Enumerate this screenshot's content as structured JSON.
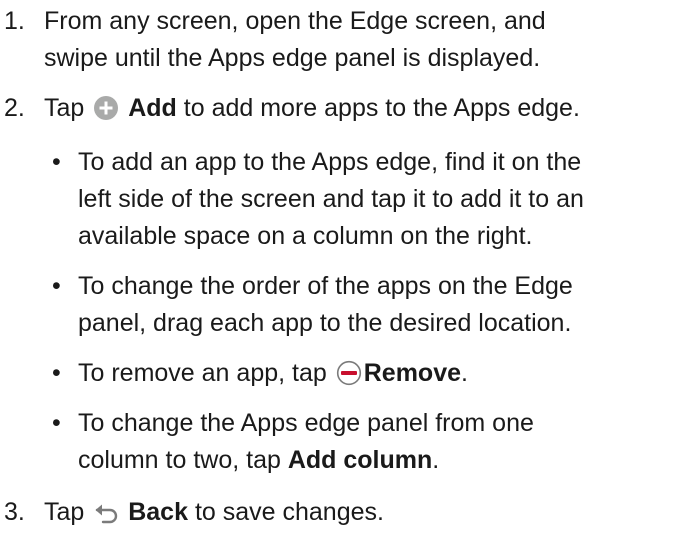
{
  "colors": {
    "text": "#1a1a1a",
    "add_icon": "#a9aaa9",
    "remove_icon_ring": "#7b7b7b",
    "remove_icon_bar": "#c8102e"
  },
  "steps": [
    {
      "number": "1.",
      "line1": "From any screen, open the Edge screen, and",
      "line2": "swipe until the Apps edge panel is displayed."
    },
    {
      "number": "2.",
      "pre": "Tap",
      "icon": "add-circle-icon",
      "bold": "Add",
      "post": "to add more apps to the Apps edge."
    },
    {
      "number": "3.",
      "pre": "Tap",
      "icon": "back-arrow-icon",
      "bold": "Back",
      "post": "to save changes."
    }
  ],
  "bullets": [
    {
      "glyph": "•",
      "line1": "To add an app to the Apps edge, find it on the",
      "line2": "left side of the screen and tap it to add it to an",
      "line3": "available space on a column on the right."
    },
    {
      "glyph": "•",
      "line1": "To change the order of the apps on the Edge",
      "line2": "panel, drag each app to the desired location."
    },
    {
      "glyph": "•",
      "pre": "To remove an app, tap",
      "icon": "remove-circle-icon",
      "bold": "Remove",
      "post": "."
    },
    {
      "glyph": "•",
      "line1": "To change the Apps edge panel from one",
      "pre2": "column to two, tap",
      "bold": "Add column",
      "post": "."
    }
  ]
}
